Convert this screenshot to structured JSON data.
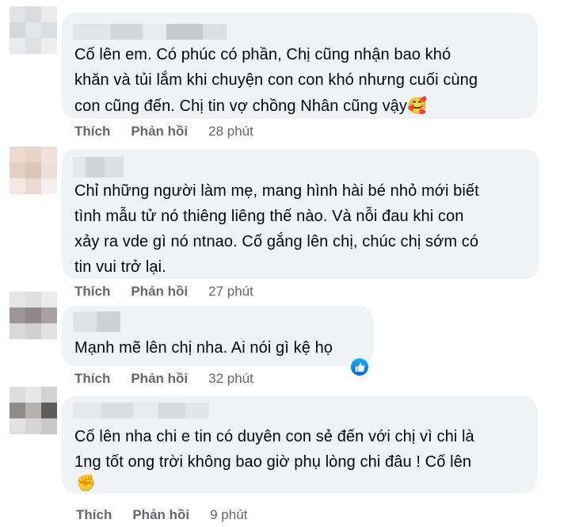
{
  "comments": [
    {
      "text": "Cố lên em. Có phúc có phần, Chị cũng nhận bao khó\nkhăn và tủi lắm khi chuyện con con khó nhưng cuối cùng\ncon cũng đến. Chị tin vợ chồng Nhân cũng vậy",
      "emoji": "🥰",
      "like": "Thích",
      "reply": "Phản hồi",
      "time": "28 phút"
    },
    {
      "text": "Chỉ những người làm mẹ, mang hình hài bé nhỏ mới biết\ntình mẫu tử nó thiêng liêng thế nào. Và nỗi đau khi con\nxảy ra vde gì nó ntnao. Cố gắng lên chị, chúc chị sớm có\ntin vui trở lại.",
      "emoji": "",
      "like": "Thích",
      "reply": "Phản hồi",
      "time": "27 phút"
    },
    {
      "text": "Mạnh mẽ lên chị nha. Ai nói gì kệ họ",
      "emoji": "",
      "like": "Thích",
      "reply": "Phản hồi",
      "time": "32 phút"
    },
    {
      "text": "Cố lên nha chi e tin có duyên con sẻ đến với chị vì chi là\n1ng tốt ong trời không bao giờ phụ lòng chi đâu ! Cố lên",
      "emoji": "✊",
      "like": "Thích",
      "reply": "Phản hồi",
      "time": "9 phút"
    }
  ],
  "icons": {
    "reaction": "like-icon",
    "like_color": "#1877f2"
  }
}
